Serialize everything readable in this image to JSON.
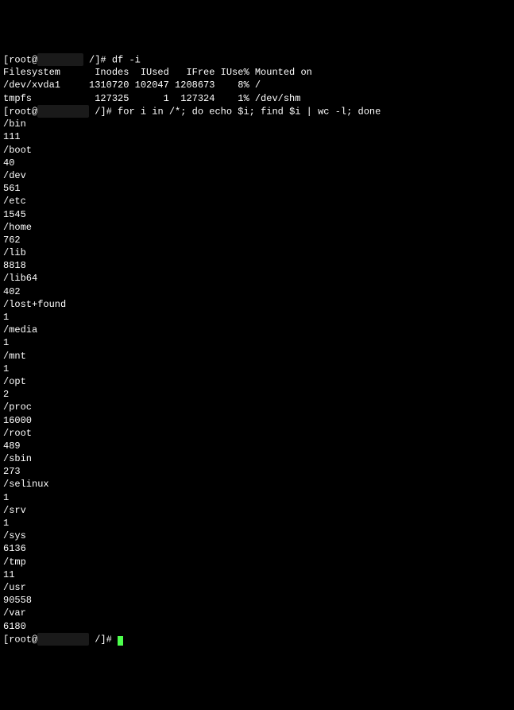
{
  "prompt1": {
    "user": "[root@",
    "host_redacted": "        ",
    "path_end": " /]# ",
    "cmd": "df -i"
  },
  "df": {
    "header": "Filesystem      Inodes  IUsed   IFree IUse% Mounted on",
    "rows": [
      "/dev/xvda1     1310720 102047 1208673    8% /",
      "tmpfs           127325      1  127324    1% /dev/shm"
    ]
  },
  "prompt2": {
    "user": "[root@",
    "host_redacted": "         ",
    "path_end": " /]# ",
    "cmd": "for i in /*; do echo $i; find $i | wc -l; done"
  },
  "entries": [
    {
      "dir": "/bin",
      "count": "111"
    },
    {
      "dir": "/boot",
      "count": "40"
    },
    {
      "dir": "/dev",
      "count": "561"
    },
    {
      "dir": "/etc",
      "count": "1545"
    },
    {
      "dir": "/home",
      "count": "762"
    },
    {
      "dir": "/lib",
      "count": "8818"
    },
    {
      "dir": "/lib64",
      "count": "402"
    },
    {
      "dir": "/lost+found",
      "count": "1"
    },
    {
      "dir": "/media",
      "count": "1"
    },
    {
      "dir": "/mnt",
      "count": "1"
    },
    {
      "dir": "/opt",
      "count": "2"
    },
    {
      "dir": "/proc",
      "count": "16000"
    },
    {
      "dir": "/root",
      "count": "489"
    },
    {
      "dir": "/sbin",
      "count": "273"
    },
    {
      "dir": "/selinux",
      "count": "1"
    },
    {
      "dir": "/srv",
      "count": "1"
    },
    {
      "dir": "/sys",
      "count": "6136"
    },
    {
      "dir": "/tmp",
      "count": "11"
    },
    {
      "dir": "/usr",
      "count": "90558"
    },
    {
      "dir": "/var",
      "count": "6180"
    }
  ],
  "prompt3": {
    "user": "[root@",
    "host_redacted": "         ",
    "path_end": " /]# "
  }
}
